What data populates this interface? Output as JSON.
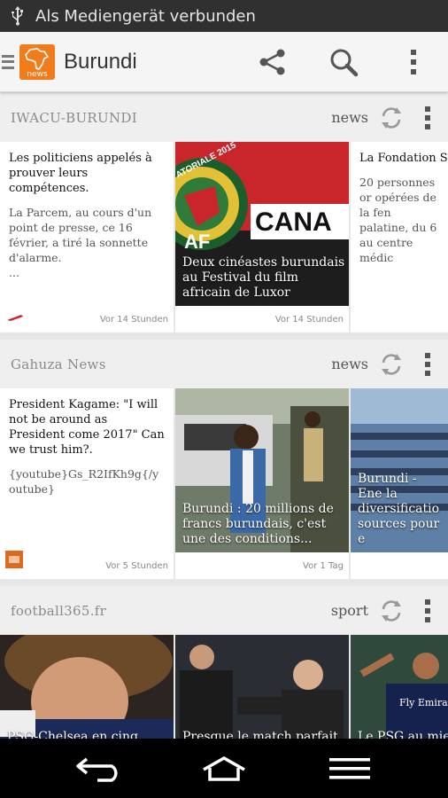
{
  "status_bar": {
    "text": "Als Mediengerät verbunden"
  },
  "action_bar": {
    "logo_text": "news",
    "title": "Burundi"
  },
  "sections": [
    {
      "source": "IWACU-BURUNDI",
      "category": "news",
      "cards": [
        {
          "headline": "Les politiciens appelés à prouver leurs compétences.",
          "excerpt": "La Parcem, au cours d'un point de presse, ce 16 février, a tiré la sonnette d'alarme.",
          "ellipsis": "...",
          "time": "Vor 14 Stunden"
        },
        {
          "caption": "Deux cinéastes burundais au Festival du film africain de Luxor",
          "image_text_1": "ATORIALE 2015",
          "image_text_2": "CANA",
          "image_text_3": "AF",
          "time": "Vor 14 Stunden"
        },
        {
          "headline": "La Fondation Sta le sourire aux pe souffrant du be",
          "excerpt": "20 personnes or opérées de la fen palatine, du 6 au centre médic"
        }
      ]
    },
    {
      "source": "Gahuza News",
      "category": "news",
      "cards": [
        {
          "headline": "President Kagame: \"I will not be around as President come 2017\" Can we trust him?.",
          "excerpt": "{youtube}Gs_R2IfKh9g{/youtube}",
          "time": "Vor 5 Stunden"
        },
        {
          "caption": "Burundi : 20 millions de francs burundais, c'est une des conditions...",
          "time": "Vor 1 Tag"
        },
        {
          "caption": "Burundi - Ene la diversificatio sources pour e"
        }
      ]
    },
    {
      "source": "football365.fr",
      "category": "sport",
      "cards": [
        {
          "caption": "PSG-Chelsea en cinq",
          "jersey": ""
        },
        {
          "caption": "Presque le match parfait"
        },
        {
          "caption": "Le PSG au mieux",
          "jersey_text": "Fly Emirates"
        }
      ]
    }
  ],
  "colors": {
    "accent": "#f07c1c",
    "refresh_icon": "#9a9a9a",
    "nav_bg": "#000000"
  },
  "icons": {
    "share": "share-icon",
    "search": "search-icon",
    "menu": "overflow-menu-icon",
    "refresh": "refresh-icon",
    "back": "back-icon",
    "home": "home-icon",
    "recent": "recent-apps-icon"
  }
}
